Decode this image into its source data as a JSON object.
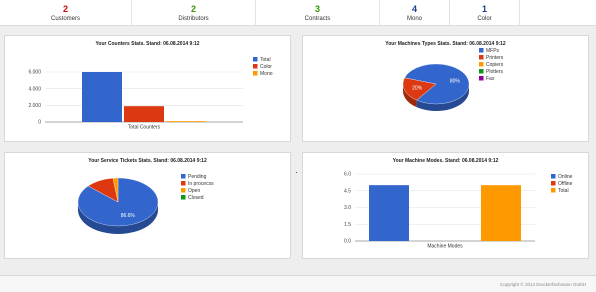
{
  "stats": [
    {
      "value": "2",
      "label": "Customers",
      "color": "#cc0000"
    },
    {
      "value": "2",
      "label": "Distributors",
      "color": "#339900"
    },
    {
      "value": "3",
      "label": "Contracts",
      "color": "#339900"
    },
    {
      "value": "4",
      "label": "Mono",
      "color": "#1a3c8f"
    },
    {
      "value": "1",
      "label": "Color",
      "color": "#1a3c8f"
    }
  ],
  "panels": {
    "counters": {
      "title": "Your Counters Stats. Stand: 06.08.2014 9:12"
    },
    "machine_types": {
      "title": "Your Machines Types Stats. Stand: 06.08.2014 9:12"
    },
    "service_tickets": {
      "title": "Your Service Tickets Stats. Stand: 06.08.2014 9:12"
    },
    "machine_modes": {
      "title": "Your Machine Modes. Stand: 06.08.2014 9:12"
    }
  },
  "chart_data": [
    {
      "type": "bar",
      "title": "Your Counters Stats. Stand: 06.08.2014 9:12",
      "categories": [
        "Total Counters"
      ],
      "series": [
        {
          "name": "Total",
          "values": [
            6000
          ],
          "color": "#3366cc"
        },
        {
          "name": "Color",
          "values": [
            1900
          ],
          "color": "#dc3912"
        },
        {
          "name": "Mono",
          "values": [
            100
          ],
          "color": "#ff9900"
        }
      ],
      "yticks": [
        "0",
        "2.000",
        "4.000",
        "6.000"
      ],
      "ylim": [
        0,
        6000
      ],
      "legend": "right",
      "grid": true
    },
    {
      "type": "pie",
      "title": "Your Machines Types Stats. Stand: 06.08.2014 9:12",
      "slices": [
        {
          "label": "MFPs",
          "value": 80,
          "display": "80%",
          "color": "#3366cc"
        },
        {
          "label": "Printers",
          "value": 20,
          "display": "20%",
          "color": "#dc3912"
        },
        {
          "label": "Copiers",
          "value": 0,
          "display": "",
          "color": "#ff9900"
        },
        {
          "label": "Plotters",
          "value": 0,
          "display": "",
          "color": "#109618"
        },
        {
          "label": "Fax",
          "value": 0,
          "display": "",
          "color": "#990099"
        }
      ],
      "legend": "right",
      "style": "3d"
    },
    {
      "type": "pie",
      "title": "Your Service Tickets Stats. Stand: 06.08.2014 9:12",
      "slices": [
        {
          "label": "Pending",
          "value": 86.6,
          "display": "86.6%",
          "color": "#3366cc"
        },
        {
          "label": "In procecss",
          "value": 11.4,
          "display": "",
          "color": "#dc3912"
        },
        {
          "label": "Open",
          "value": 2,
          "display": "",
          "color": "#ff9900"
        },
        {
          "label": "Closed",
          "value": 0,
          "display": "",
          "color": "#109618"
        }
      ],
      "legend": "right",
      "style": "3d"
    },
    {
      "type": "bar",
      "title": "Your Machine Modes. Stand: 06.08.2014 9:12",
      "categories": [
        "Machine Modes"
      ],
      "series": [
        {
          "name": "Online",
          "values": [
            5
          ],
          "color": "#3366cc"
        },
        {
          "name": "Offline",
          "values": [
            0
          ],
          "color": "#dc3912"
        },
        {
          "name": "Total",
          "values": [
            5
          ],
          "color": "#ff9900"
        }
      ],
      "yticks": [
        "0.0",
        "1.5",
        "3.0",
        "4.5",
        "6.0"
      ],
      "ylim": [
        0,
        6
      ],
      "legend": "right",
      "grid": true
    }
  ],
  "footer": {
    "copyright": "Copyright © 2014 Druckerfachmann GmbH"
  }
}
